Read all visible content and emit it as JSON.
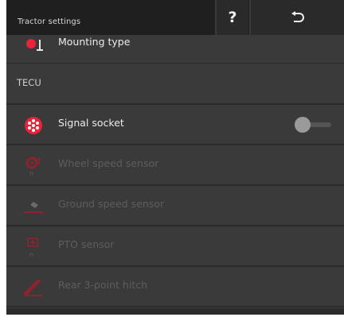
{
  "header": {
    "title": "Tractor settings",
    "help_label": "?",
    "back_icon": "return-arrow-icon"
  },
  "rows": {
    "mounting_type": {
      "label": "Mounting type",
      "icon": "mounting-type-icon"
    },
    "signal_socket": {
      "label": "Signal socket",
      "icon": "signal-socket-icon",
      "toggle_on": false
    },
    "wheel_speed_sensor": {
      "label": "Wheel speed sensor",
      "icon": "wheel-speed-sensor-icon",
      "disabled": true
    },
    "ground_speed_sensor": {
      "label": "Ground speed sensor",
      "icon": "ground-speed-sensor-icon",
      "disabled": true
    },
    "pto_sensor": {
      "label": "PTO sensor",
      "icon": "pto-sensor-icon",
      "disabled": true
    },
    "rear_hitch": {
      "label": "Rear 3-point hitch",
      "icon": "rear-hitch-icon",
      "disabled": true
    }
  },
  "section": {
    "tecu_label": "TECU"
  },
  "colors": {
    "accent_red": "#e8233a",
    "disabled_red": "#8a2530",
    "background": "#3a3a3a",
    "header": "#1f1f1f"
  }
}
